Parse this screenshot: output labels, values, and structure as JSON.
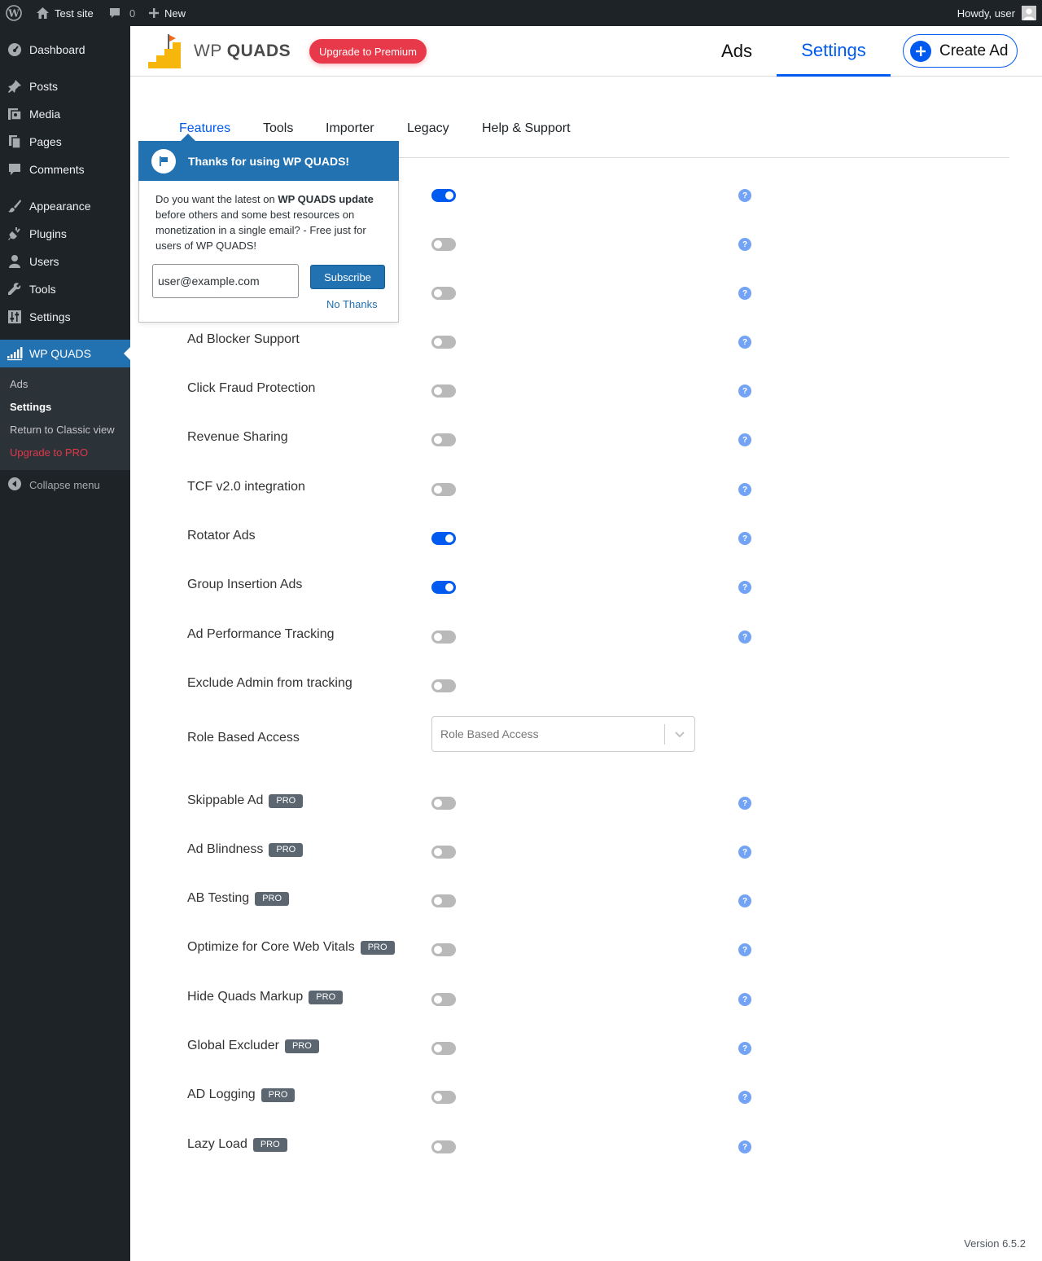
{
  "adminbar": {
    "site_name": "Test site",
    "comments_count": "0",
    "new_label": "New",
    "howdy": "Howdy, user"
  },
  "sidebar": {
    "items": [
      {
        "label": "Dashboard",
        "icon": "dashboard-icon"
      },
      {
        "label": "Posts",
        "icon": "pin-icon"
      },
      {
        "label": "Media",
        "icon": "media-icon"
      },
      {
        "label": "Pages",
        "icon": "pages-icon"
      },
      {
        "label": "Comments",
        "icon": "comment-icon"
      },
      {
        "label": "Appearance",
        "icon": "brush-icon"
      },
      {
        "label": "Plugins",
        "icon": "plug-icon"
      },
      {
        "label": "Users",
        "icon": "user-icon"
      },
      {
        "label": "Tools",
        "icon": "wrench-icon"
      },
      {
        "label": "Settings",
        "icon": "sliders-icon"
      },
      {
        "label": "WP QUADS",
        "icon": "signal-bars-icon"
      }
    ],
    "submenu": [
      "Ads",
      "Settings",
      "Return to Classic view",
      "Upgrade to PRO"
    ],
    "collapse": "Collapse menu"
  },
  "header": {
    "logo_light": "WP",
    "logo_bold": "QUADS",
    "upgrade_label": "Upgrade to Premium",
    "tabs": [
      "Ads",
      "Settings"
    ],
    "create_ad": "Create Ad"
  },
  "subtabs": [
    "Features",
    "Tools",
    "Importer",
    "Legacy",
    "Help & Support"
  ],
  "popup": {
    "title": "Thanks for using WP QUADS!",
    "body_before": "Do you want the latest on ",
    "body_bold": "WP QUADS update",
    "body_after": " before others and some best resources on monetization in a single email? - Free just for users of WP QUADS!",
    "email_value": "user@example.com",
    "subscribe": "Subscribe",
    "no_thanks": "No Thanks"
  },
  "settings": [
    {
      "label": "Ad Blocker Support",
      "on": false,
      "pro": false,
      "help": true
    },
    {
      "label": "Click Fraud Protection",
      "on": false,
      "pro": false,
      "help": true
    },
    {
      "label": "Revenue Sharing",
      "on": false,
      "pro": false,
      "help": true
    },
    {
      "label": "TCF v2.0 integration",
      "on": false,
      "pro": false,
      "help": true
    },
    {
      "label": "Rotator Ads",
      "on": true,
      "pro": false,
      "help": true
    },
    {
      "label": "Group Insertion Ads",
      "on": true,
      "pro": false,
      "help": true
    },
    {
      "label": "Ad Performance Tracking",
      "on": false,
      "pro": false,
      "help": true
    },
    {
      "label": "Exclude Admin from tracking",
      "on": false,
      "pro": false,
      "help": false
    },
    {
      "label": "Skippable Ad",
      "on": false,
      "pro": true,
      "help": true
    },
    {
      "label": "Ad Blindness",
      "on": false,
      "pro": true,
      "help": true
    },
    {
      "label": "AB Testing",
      "on": false,
      "pro": true,
      "help": true
    },
    {
      "label": "Optimize for Core Web Vitals",
      "on": false,
      "pro": true,
      "help": true
    },
    {
      "label": "Hide Quads Markup",
      "on": false,
      "pro": true,
      "help": true
    },
    {
      "label": "Global Excluder",
      "on": false,
      "pro": true,
      "help": true
    },
    {
      "label": "AD Logging",
      "on": false,
      "pro": true,
      "help": true
    },
    {
      "label": "Lazy Load",
      "on": false,
      "pro": true,
      "help": true
    }
  ],
  "hidden_toggles": [
    true,
    false,
    false
  ],
  "role_access": {
    "label": "Role Based Access",
    "placeholder": "Role Based Access"
  },
  "pro_badge": "PRO",
  "help_glyph": "?",
  "version": "Version 6.5.2",
  "colors": {
    "accent": "#005af0",
    "wp_blue": "#2271b1",
    "upgrade_red": "#e8394a",
    "admin_dark": "#1d2327"
  }
}
